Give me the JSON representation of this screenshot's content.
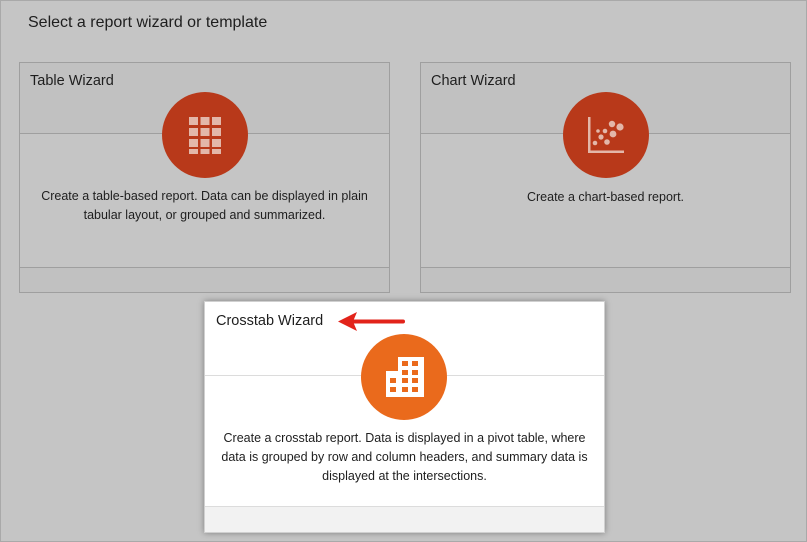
{
  "page": {
    "heading": "Select a report wizard or template"
  },
  "cards": {
    "table": {
      "title": "Table Wizard",
      "description": "Create a table-based report. Data can be displayed in plain tabular layout, or grouped and summarized.",
      "icon": "table-grid-icon"
    },
    "chart": {
      "title": "Chart Wizard",
      "description": "Create a chart-based report.",
      "icon": "scatter-chart-icon"
    },
    "crosstab": {
      "title": "Crosstab Wizard",
      "description": "Create a crosstab report. Data is displayed in a pivot table, where data is grouped by row and column headers, and summary data is displayed at the intersections.",
      "icon": "crosstab-grid-icon",
      "selected": true
    }
  },
  "colors": {
    "badge_default": "#b8391a",
    "badge_selected": "#ea6a1c",
    "annotation_arrow": "#e2231a",
    "overlay_background": "#c5c5c5"
  }
}
